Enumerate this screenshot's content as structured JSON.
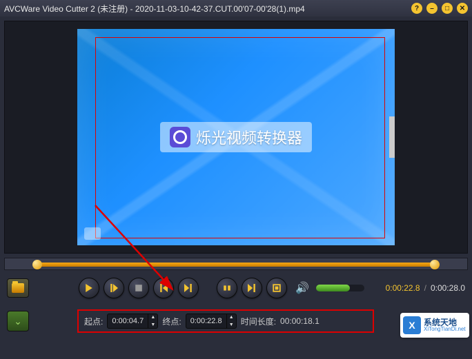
{
  "titlebar": {
    "app": "AVCWare Video Cutter 2",
    "status": "(未注册)",
    "file": "2020-11-03-10-42-37.CUT.00'07-00'28(1).mp4"
  },
  "overlay": {
    "text": "烁光视频转换器"
  },
  "time": {
    "current": "0:00:22.8",
    "total": "0:00:28.0"
  },
  "cut": {
    "start_label": "起点:",
    "start_value": "0:00:04.7",
    "end_label": "终点:",
    "end_value": "0:00:22.8",
    "duration_label": "时间长度:",
    "duration_value": "00:00:18.1"
  },
  "watermark": {
    "cn": "系统天地",
    "en": "XiTongTianDi.net"
  },
  "icons": {
    "help": "?",
    "min": "–",
    "max": "□",
    "close": "✕",
    "play": "▶",
    "stop": "■",
    "prev": "▮◀",
    "next": "▶▮",
    "speaker": "🔊",
    "chev": "⌄"
  }
}
